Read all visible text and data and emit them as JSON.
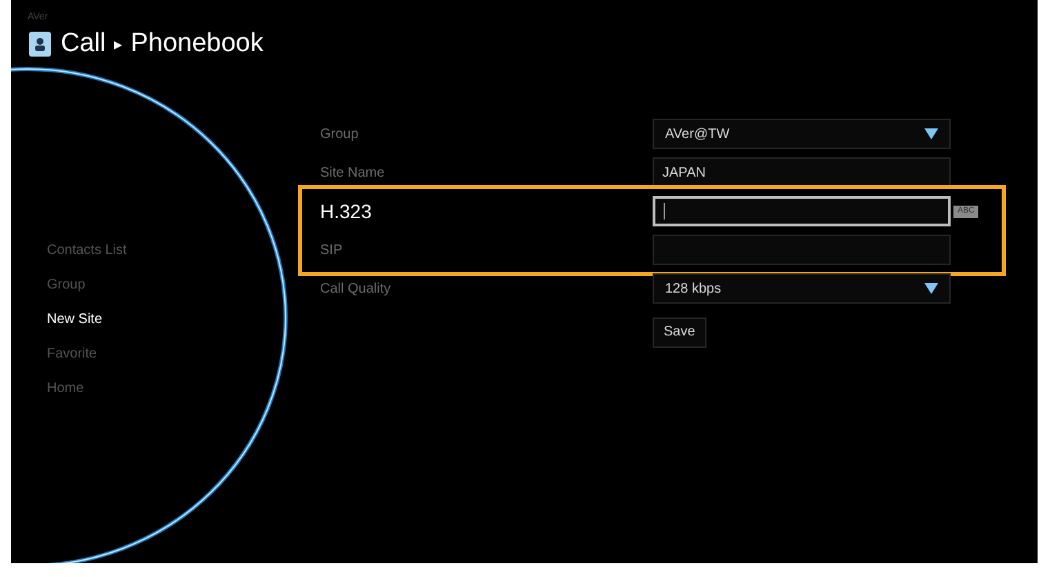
{
  "brand": "AVer",
  "header": {
    "title": "Call",
    "separator": "▸",
    "subtitle": "Phonebook"
  },
  "sidebar": {
    "items": [
      {
        "label": "Contacts List",
        "selected": false
      },
      {
        "label": "Group",
        "selected": false
      },
      {
        "label": "New Site",
        "selected": true
      },
      {
        "label": "Favorite",
        "selected": false
      },
      {
        "label": "Home",
        "selected": false
      }
    ]
  },
  "form": {
    "sections": [
      {
        "kind": "plain",
        "rows": [
          {
            "kind": "dropdown",
            "label": "Group",
            "value": "AVer@TW",
            "focused": false
          },
          {
            "kind": "text",
            "label": "Site Name",
            "value": "JAPAN",
            "focused": false
          }
        ]
      },
      {
        "kind": "highlight",
        "rows": [
          {
            "kind": "text",
            "label": "H.323",
            "focused": true,
            "input_mode": "ABC"
          },
          {
            "kind": "text",
            "label": "SIP",
            "focused": false
          }
        ]
      },
      {
        "kind": "plain",
        "rows": [
          {
            "kind": "dropdown",
            "label": "Call Quality",
            "value": "128 kbps",
            "focused": false
          }
        ]
      }
    ],
    "button": "Save"
  }
}
